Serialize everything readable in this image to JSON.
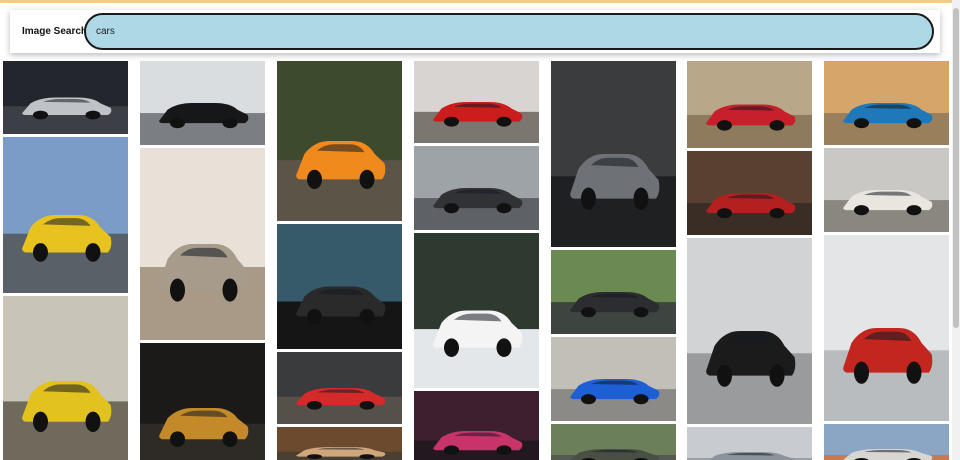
{
  "app": {
    "title": "Image Search"
  },
  "search": {
    "value": "cars",
    "placeholder": ""
  },
  "results": [
    {
      "name": "result-image-1",
      "icon": "car-photo-icon",
      "bg": "#23262c",
      "ground": "#3c3f45",
      "car": "#bfc3c8"
    },
    {
      "name": "result-image-2",
      "icon": "car-photo-icon",
      "bg": "#7a9cc7",
      "ground": "#5a6068",
      "car": "#e8c31f"
    },
    {
      "name": "result-image-3",
      "icon": "car-photo-icon",
      "bg": "#c9c4b8",
      "ground": "#6f6a5c",
      "car": "#e2c21e"
    },
    {
      "name": "result-image-4",
      "icon": "car-photo-icon",
      "bg": "#d9dde0",
      "ground": "#7b7f84",
      "car": "#161718"
    },
    {
      "name": "result-image-5",
      "icon": "car-photo-icon",
      "bg": "#e7e1d8",
      "ground": "#a89a86",
      "car": "#a79c8c"
    },
    {
      "name": "result-image-6",
      "icon": "car-photo-icon",
      "bg": "#1b1a19",
      "ground": "#2e2b26",
      "car": "#c48a2a"
    },
    {
      "name": "result-image-7",
      "icon": "car-photo-icon",
      "bg": "#3d4a2e",
      "ground": "#5c5446",
      "car": "#f08a1c"
    },
    {
      "name": "result-image-8",
      "icon": "car-photo-icon",
      "bg": "#365a6a",
      "ground": "#151515",
      "car": "#2a2a2a"
    },
    {
      "name": "result-image-9",
      "icon": "car-photo-icon",
      "bg": "#3a3b3d",
      "ground": "#55504a",
      "car": "#d42a2a"
    },
    {
      "name": "result-image-10",
      "icon": "car-photo-icon",
      "bg": "#6b4a2e",
      "ground": "#4a3f31",
      "car": "#cfa77a"
    },
    {
      "name": "result-image-11",
      "icon": "car-photo-icon",
      "bg": "#d8d4d1",
      "ground": "#7c7670",
      "car": "#cc1d1d"
    },
    {
      "name": "result-image-12",
      "icon": "car-photo-icon",
      "bg": "#9ea3a8",
      "ground": "#5e6166",
      "car": "#303236"
    },
    {
      "name": "result-image-13",
      "icon": "car-photo-icon",
      "bg": "#2e3a30",
      "ground": "#e4e7ea",
      "car": "#f4f4f4"
    },
    {
      "name": "result-image-14",
      "icon": "car-photo-icon",
      "bg": "#3d2030",
      "ground": "#241820",
      "car": "#c8336a"
    },
    {
      "name": "result-image-15",
      "icon": "car-photo-icon",
      "bg": "#3a3c3e",
      "ground": "#1f2022",
      "car": "#6e7176"
    },
    {
      "name": "result-image-16",
      "icon": "car-photo-icon",
      "bg": "#6b8a52",
      "ground": "#3e4440",
      "car": "#2b2d31"
    },
    {
      "name": "result-image-17",
      "icon": "car-photo-icon",
      "bg": "#c2beb8",
      "ground": "#8c8a86",
      "car": "#1f5fd6"
    },
    {
      "name": "result-image-18",
      "icon": "car-photo-icon",
      "bg": "#6a7f5a",
      "ground": "#575a4e",
      "car": "#4a4f46"
    },
    {
      "name": "result-image-19",
      "icon": "car-photo-icon",
      "bg": "#b9a78a",
      "ground": "#8e7b5e",
      "car": "#c8202a"
    },
    {
      "name": "result-image-20",
      "icon": "car-photo-icon",
      "bg": "#5a4030",
      "ground": "#3a2d25",
      "car": "#b3201f"
    },
    {
      "name": "result-image-21",
      "icon": "car-photo-icon",
      "bg": "#d2d3d4",
      "ground": "#9a9b9d",
      "car": "#1b1b1c"
    },
    {
      "name": "result-image-22",
      "icon": "car-photo-icon",
      "bg": "#c8ccd0",
      "ground": "#9aa0a6",
      "car": "#8d939a"
    },
    {
      "name": "result-image-23",
      "icon": "car-photo-icon",
      "bg": "#d6a56a",
      "ground": "#9a7f5d",
      "car": "#1f78b8"
    },
    {
      "name": "result-image-24",
      "icon": "car-photo-icon",
      "bg": "#c9c8c4",
      "ground": "#8a8780",
      "car": "#e8e6df"
    },
    {
      "name": "result-image-25",
      "icon": "car-photo-icon",
      "bg": "#e3e5e7",
      "ground": "#b9bcbf",
      "car": "#c2261f"
    },
    {
      "name": "result-image-26",
      "icon": "car-photo-icon",
      "bg": "#8aa6c4",
      "ground": "#c77a4e",
      "car": "#d8d6d3"
    }
  ]
}
